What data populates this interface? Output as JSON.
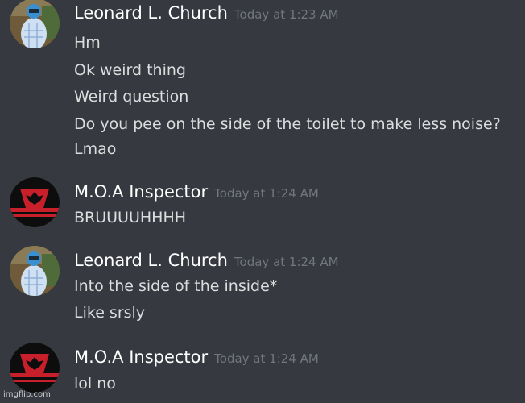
{
  "messages": [
    {
      "author": "Leonard L. Church",
      "avatar_icon": "user-photo-avatar",
      "timestamp": "Today at 1:23 AM",
      "lines": [
        "Hm",
        "Ok weird thing",
        "Weird question",
        "Do you pee on the side of the toilet to make less noise?",
        "Lmao"
      ]
    },
    {
      "author": "M.O.A Inspector",
      "avatar_icon": "eagle-emblem-avatar",
      "timestamp": "Today at 1:24 AM",
      "lines": [
        "BRUUUUHHHH"
      ]
    },
    {
      "author": "Leonard L. Church",
      "avatar_icon": "user-photo-avatar",
      "timestamp": "Today at 1:24 AM",
      "lines": [
        "Into the side of the inside*",
        "Like srsly"
      ]
    },
    {
      "author": "M.O.A Inspector",
      "avatar_icon": "eagle-emblem-avatar",
      "timestamp": "Today at 1:24 AM",
      "lines": [
        "lol no"
      ]
    }
  ],
  "watermark": "imgflip.com",
  "colors": {
    "background": "#36393f",
    "username": "#ffffff",
    "timestamp": "#72767d",
    "message_text": "#dcddde",
    "emblem_red": "#c8202a"
  }
}
